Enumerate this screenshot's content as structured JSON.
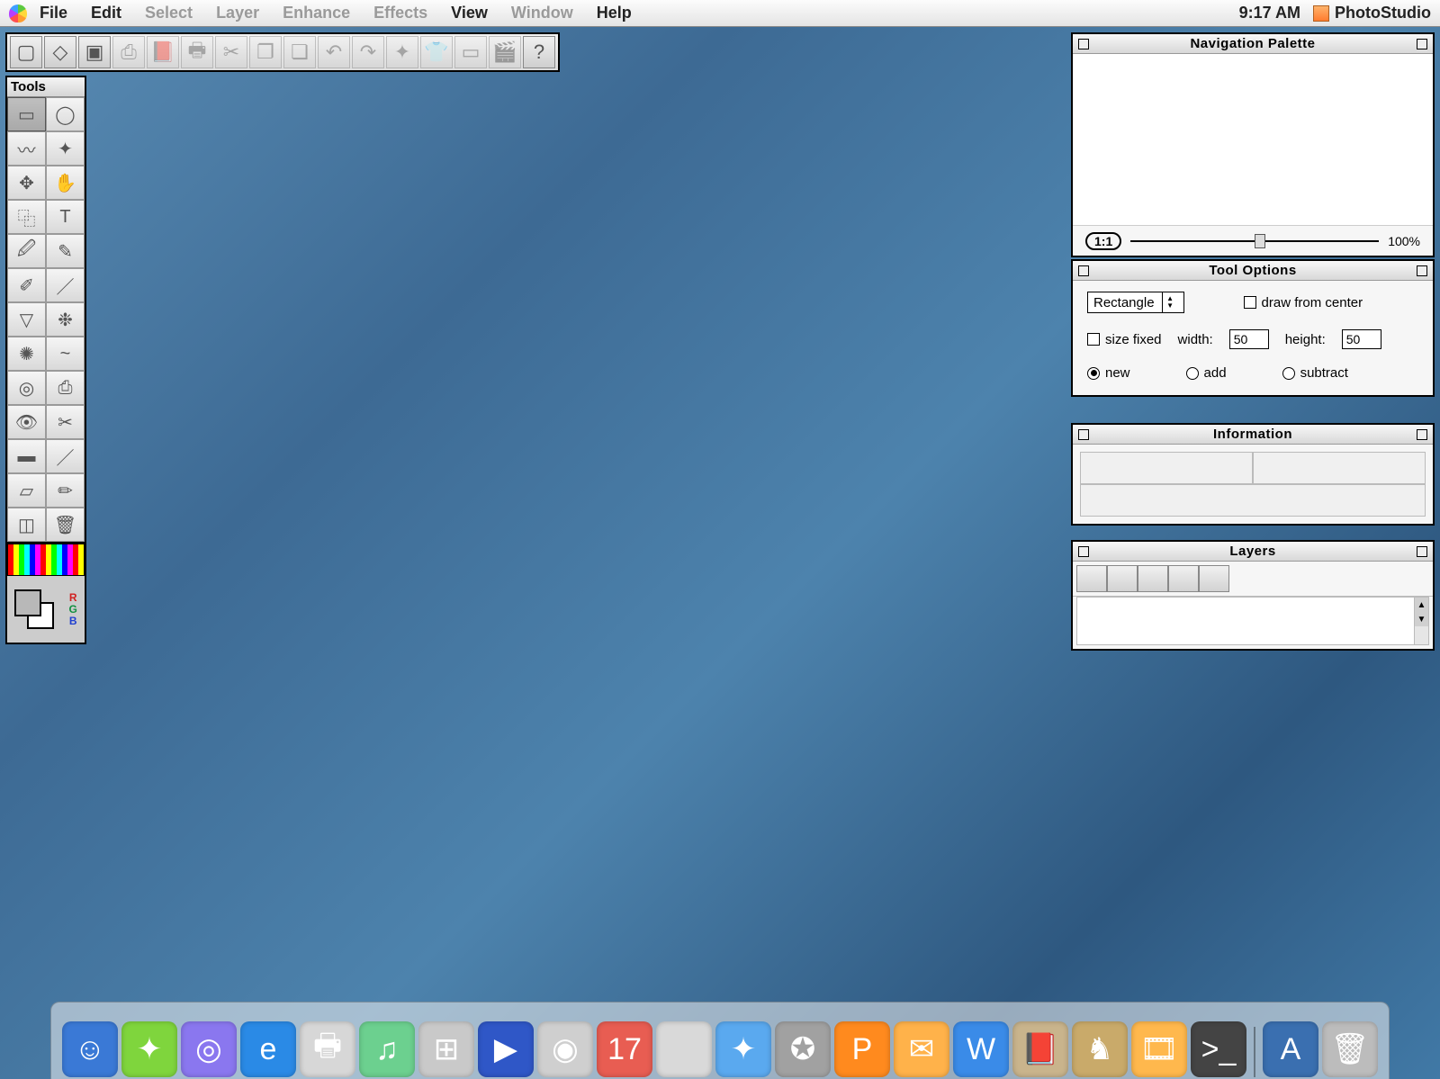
{
  "menubar": {
    "items": [
      {
        "label": "File",
        "dim": false
      },
      {
        "label": "Edit",
        "dim": false
      },
      {
        "label": "Select",
        "dim": true
      },
      {
        "label": "Layer",
        "dim": true
      },
      {
        "label": "Enhance",
        "dim": true
      },
      {
        "label": "Effects",
        "dim": true
      },
      {
        "label": "View",
        "dim": false
      },
      {
        "label": "Window",
        "dim": true
      },
      {
        "label": "Help",
        "dim": false
      }
    ],
    "clock": "9:17 AM",
    "app_name": "PhotoStudio"
  },
  "quickbar": {
    "items": [
      {
        "name": "new",
        "glyph": "▢",
        "dim": false
      },
      {
        "name": "open",
        "glyph": "◇",
        "dim": false
      },
      {
        "name": "acquire",
        "glyph": "▣",
        "dim": false
      },
      {
        "name": "save",
        "glyph": "⎙",
        "dim": true
      },
      {
        "name": "album",
        "glyph": "📕",
        "dim": true
      },
      {
        "name": "print",
        "glyph": "🖶",
        "dim": true
      },
      {
        "name": "cut",
        "glyph": "✂",
        "dim": true
      },
      {
        "name": "copy",
        "glyph": "❐",
        "dim": true
      },
      {
        "name": "paste",
        "glyph": "❏",
        "dim": true
      },
      {
        "name": "undo",
        "glyph": "↶",
        "dim": true
      },
      {
        "name": "redo",
        "glyph": "↷",
        "dim": true
      },
      {
        "name": "wand",
        "glyph": "✦",
        "dim": true
      },
      {
        "name": "stitch",
        "glyph": "👕",
        "dim": true
      },
      {
        "name": "panorama",
        "glyph": "▭",
        "dim": true
      },
      {
        "name": "slideshow",
        "glyph": "🎬",
        "dim": true
      },
      {
        "name": "help",
        "glyph": "?",
        "dim": false
      }
    ]
  },
  "tools": {
    "title": "Tools",
    "list": [
      {
        "name": "rect-select",
        "sel": true
      },
      {
        "name": "ellipse-select"
      },
      {
        "name": "lasso"
      },
      {
        "name": "magic-wand"
      },
      {
        "name": "move"
      },
      {
        "name": "hand"
      },
      {
        "name": "crop-free"
      },
      {
        "name": "text"
      },
      {
        "name": "eyedropper"
      },
      {
        "name": "pen"
      },
      {
        "name": "pencil"
      },
      {
        "name": "line"
      },
      {
        "name": "bucket"
      },
      {
        "name": "spray"
      },
      {
        "name": "brightness"
      },
      {
        "name": "smudge"
      },
      {
        "name": "clone"
      },
      {
        "name": "stamp"
      },
      {
        "name": "red-eye"
      },
      {
        "name": "scissors"
      },
      {
        "name": "gradient"
      },
      {
        "name": "brush"
      },
      {
        "name": "transform"
      },
      {
        "name": "color-picker"
      },
      {
        "name": "crop"
      },
      {
        "name": "trash"
      }
    ]
  },
  "nav": {
    "title": "Navigation Palette",
    "one_one_label": "1:1",
    "zoom_pct": "100%"
  },
  "opts": {
    "title": "Tool Options",
    "shape_label": "Rectangle",
    "draw_from_center": "draw from center",
    "size_fixed": "size fixed",
    "width_label": "width:",
    "width_value": "50",
    "height_label": "height:",
    "height_value": "50",
    "mode_new": "new",
    "mode_add": "add",
    "mode_subtract": "subtract"
  },
  "info": {
    "title": "Information"
  },
  "layers": {
    "title": "Layers"
  },
  "dock": {
    "items": [
      {
        "name": "finder",
        "bg": "#3a79d6",
        "glyph": "☺"
      },
      {
        "name": "ichat",
        "bg": "#7fd53d",
        "glyph": "✦"
      },
      {
        "name": "quicktime",
        "bg": "#8a77ef",
        "glyph": "◎"
      },
      {
        "name": "ie",
        "bg": "#2a8ae6",
        "glyph": "e"
      },
      {
        "name": "printer",
        "bg": "#d7d7d7",
        "glyph": "🖶"
      },
      {
        "name": "itunes",
        "bg": "#6cd08f",
        "glyph": "♫"
      },
      {
        "name": "calculator",
        "bg": "#c9c9c9",
        "glyph": "⊞"
      },
      {
        "name": "mplayer",
        "bg": "#2f57c7",
        "glyph": "▶"
      },
      {
        "name": "dvd",
        "bg": "#cfcfcf",
        "glyph": "◉"
      },
      {
        "name": "ical",
        "bg": "#e85d52",
        "glyph": "17"
      },
      {
        "name": "sysprefs",
        "bg": "#d9d9d9",
        "glyph": ""
      },
      {
        "name": "safari",
        "bg": "#5aa9ef",
        "glyph": "✦"
      },
      {
        "name": "compass",
        "bg": "#a1a1a1",
        "glyph": "✪"
      },
      {
        "name": "powerpoint",
        "bg": "#ff8a1e",
        "glyph": "P"
      },
      {
        "name": "entourage",
        "bg": "#ffb24a",
        "glyph": "✉"
      },
      {
        "name": "word",
        "bg": "#3a8be8",
        "glyph": "W"
      },
      {
        "name": "addressbook",
        "bg": "#c9b48c",
        "glyph": "📕"
      },
      {
        "name": "chess",
        "bg": "#c9aa6a",
        "glyph": "♞"
      },
      {
        "name": "film",
        "bg": "#ffb84d",
        "glyph": "🎞"
      },
      {
        "name": "terminal",
        "bg": "#444",
        "glyph": ">_"
      }
    ],
    "right": [
      {
        "name": "apps-folder",
        "bg": "#3a6fb0",
        "glyph": "A"
      },
      {
        "name": "trash",
        "bg": "#bcbcbc",
        "glyph": "🗑"
      }
    ]
  }
}
